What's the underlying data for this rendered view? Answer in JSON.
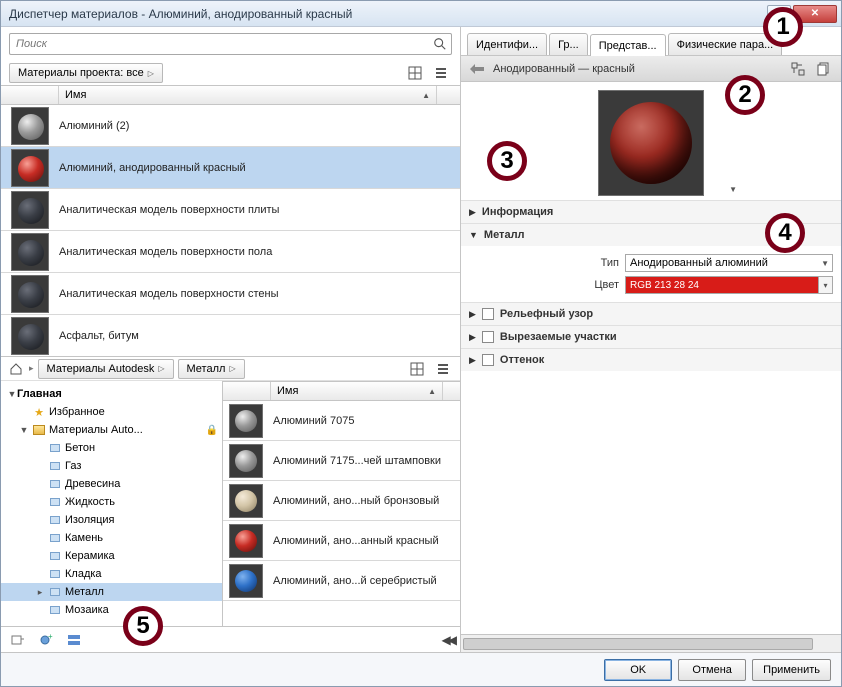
{
  "window": {
    "title": "Диспетчер материалов - Алюминий, анодированный красный"
  },
  "search": {
    "placeholder": "Поиск"
  },
  "project_filter": {
    "label": "Материалы проекта: все"
  },
  "columns": {
    "name": "Имя"
  },
  "project_materials": [
    {
      "label": "Алюминий (2)",
      "sphere": "grey"
    },
    {
      "label": "Алюминий, анодированный красный",
      "sphere": "red",
      "selected": true
    },
    {
      "label": "Аналитическая модель поверхности плиты",
      "sphere": "dark"
    },
    {
      "label": "Аналитическая модель поверхности пола",
      "sphere": "dark"
    },
    {
      "label": "Аналитическая модель поверхности стены",
      "sphere": "dark"
    },
    {
      "label": "Асфальт, битум",
      "sphere": "dark"
    }
  ],
  "library_crumb": {
    "root": "Материалы Autodesk",
    "leaf": "Металл"
  },
  "tree": {
    "root": "Главная",
    "favorites": "Избранное",
    "autodesk": "Материалы Auto...",
    "cats": [
      "Бетон",
      "Газ",
      "Древесина",
      "Жидкость",
      "Изоляция",
      "Камень",
      "Керамика",
      "Кладка",
      "Металл",
      "Мозаика"
    ],
    "selected": "Металл"
  },
  "library_materials": [
    {
      "label": "Алюминий 7075",
      "sphere": "grey"
    },
    {
      "label": "Алюминий 7175...чей штамповки",
      "sphere": "grey"
    },
    {
      "label": "Алюминий, ано...ный бронзовый",
      "sphere": "tan"
    },
    {
      "label": "Алюминий, ано...анный красный",
      "sphere": "red"
    },
    {
      "label": "Алюминий, ано...й серебристый",
      "sphere": "blue"
    }
  ],
  "tabs": {
    "identity": "Идентифи...",
    "graphics": "Гр...",
    "appearance": "Представ...",
    "physical": "Физические пара..."
  },
  "asset": {
    "title": "Анодированный — красный"
  },
  "sections": {
    "info": "Информация",
    "metal": "Металл",
    "relief": "Рельефный узор",
    "cutouts": "Вырезаемые участки",
    "tint": "Оттенок"
  },
  "props": {
    "type_label": "Тип",
    "type_value": "Анодированный алюминий",
    "color_label": "Цвет",
    "color_value": "RGB 213 28 24"
  },
  "buttons": {
    "ok": "OK",
    "cancel": "Отмена",
    "apply": "Применить"
  },
  "callouts": {
    "c1": "1",
    "c2": "2",
    "c3": "3",
    "c4": "4",
    "c5": "5"
  }
}
